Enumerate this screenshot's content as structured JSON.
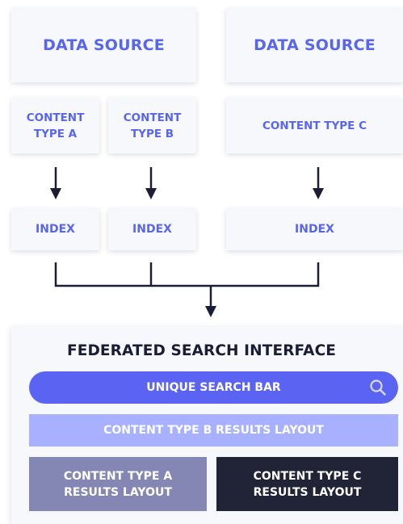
{
  "sources": [
    {
      "label": "DATA SOURCE"
    },
    {
      "label": "DATA SOURCE"
    }
  ],
  "content_types": [
    {
      "label": "CONTENT\nTYPE A"
    },
    {
      "label": "CONTENT\nTYPE B"
    },
    {
      "label": "CONTENT TYPE C"
    }
  ],
  "indexes": [
    {
      "label": "INDEX"
    },
    {
      "label": "INDEX"
    },
    {
      "label": "INDEX"
    }
  ],
  "interface": {
    "title": "FEDERATED SEARCH INTERFACE",
    "search_bar_label": "UNIQUE SEARCH BAR",
    "search_icon": "search-icon",
    "layout_b": "CONTENT TYPE B RESULTS LAYOUT",
    "layout_a": "CONTENT TYPE A\nRESULTS LAYOUT",
    "layout_c": "CONTENT TYPE C\nRESULTS LAYOUT"
  },
  "colors": {
    "accent": "#5865ef",
    "search_bar": "#5b64f2",
    "layout_b": "#a7b1ff",
    "layout_a": "#8487b3",
    "layout_c": "#212437",
    "connector": "#1a1d33"
  }
}
